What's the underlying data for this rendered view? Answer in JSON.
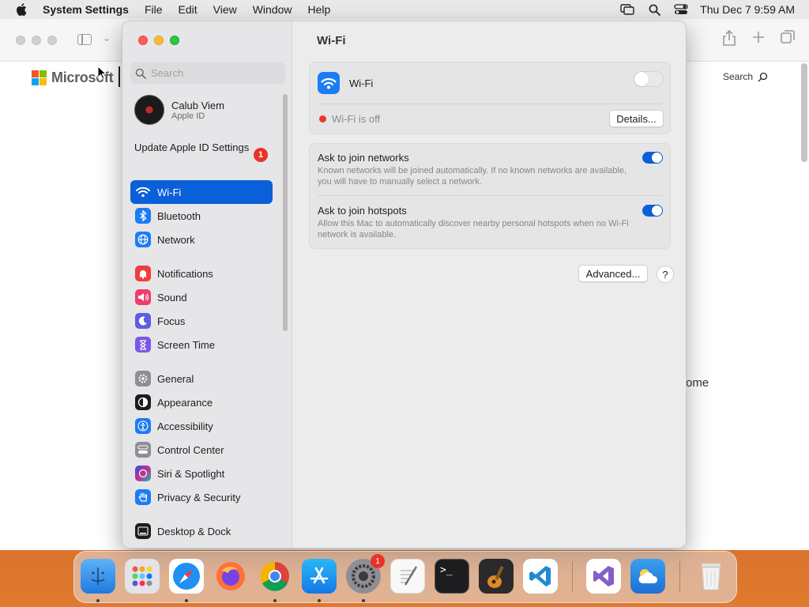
{
  "menubar": {
    "app_name": "System Settings",
    "menus": [
      "File",
      "Edit",
      "View",
      "Window",
      "Help"
    ],
    "clock": "Thu Dec 7  9:59 AM"
  },
  "browser": {
    "brand": "Microsoft",
    "search_label": "Search",
    "partial_text": "ome"
  },
  "sidebar": {
    "search_placeholder": "Search",
    "user_name": "Calub Viem",
    "user_sub": "Apple ID",
    "update_label": "Update Apple ID Settings",
    "update_badge": "1",
    "items": [
      {
        "label": "Wi-Fi",
        "icon": "wifi-icon",
        "color": "#1c7cf4"
      },
      {
        "label": "Bluetooth",
        "icon": "bluetooth-icon",
        "color": "#1c7cf4"
      },
      {
        "label": "Network",
        "icon": "globe-icon",
        "color": "#1c7cf4"
      },
      {
        "label": "Notifications",
        "icon": "bell-icon",
        "color": "#ef3e3e"
      },
      {
        "label": "Sound",
        "icon": "speaker-icon",
        "color": "#ef3e6a"
      },
      {
        "label": "Focus",
        "icon": "moon-icon",
        "color": "#5e5ce6"
      },
      {
        "label": "Screen Time",
        "icon": "hourglass-icon",
        "color": "#7a58e6"
      },
      {
        "label": "General",
        "icon": "gear-icon",
        "color": "#8e8e93"
      },
      {
        "label": "Appearance",
        "icon": "appearance-icon",
        "color": "#1d1d1f"
      },
      {
        "label": "Accessibility",
        "icon": "accessibility-icon",
        "color": "#1c7cf4"
      },
      {
        "label": "Control Center",
        "icon": "control-center-icon",
        "color": "#8e8e93"
      },
      {
        "label": "Siri & Spotlight",
        "icon": "siri-icon",
        "color": "#b0358f"
      },
      {
        "label": "Privacy & Security",
        "icon": "hand-icon",
        "color": "#1c7cf4"
      },
      {
        "label": "Desktop & Dock",
        "icon": "dock-icon",
        "color": "#1d1d1f"
      }
    ]
  },
  "content": {
    "title": "Wi-Fi",
    "wifi_label": "Wi-Fi",
    "wifi_status": "Wi-Fi is off",
    "details_button": "Details...",
    "ask_networks_title": "Ask to join networks",
    "ask_networks_desc": "Known networks will be joined automatically. If no known networks are available, you will have to manually select a network.",
    "ask_hotspots_title": "Ask to join hotspots",
    "ask_hotspots_desc": "Allow this Mac to automatically discover nearby personal hotspots when no Wi-Fi network is available.",
    "advanced_button": "Advanced...",
    "help_button": "?"
  },
  "dock": {
    "apps": [
      "Finder",
      "Launchpad",
      "Safari",
      "Firefox",
      "Chrome",
      "App Store",
      "System Settings",
      "TextEdit",
      "Terminal",
      "GarageBand",
      "VS Code",
      "Visual Studio",
      "Weather",
      "Trash"
    ],
    "settings_badge": "1"
  }
}
